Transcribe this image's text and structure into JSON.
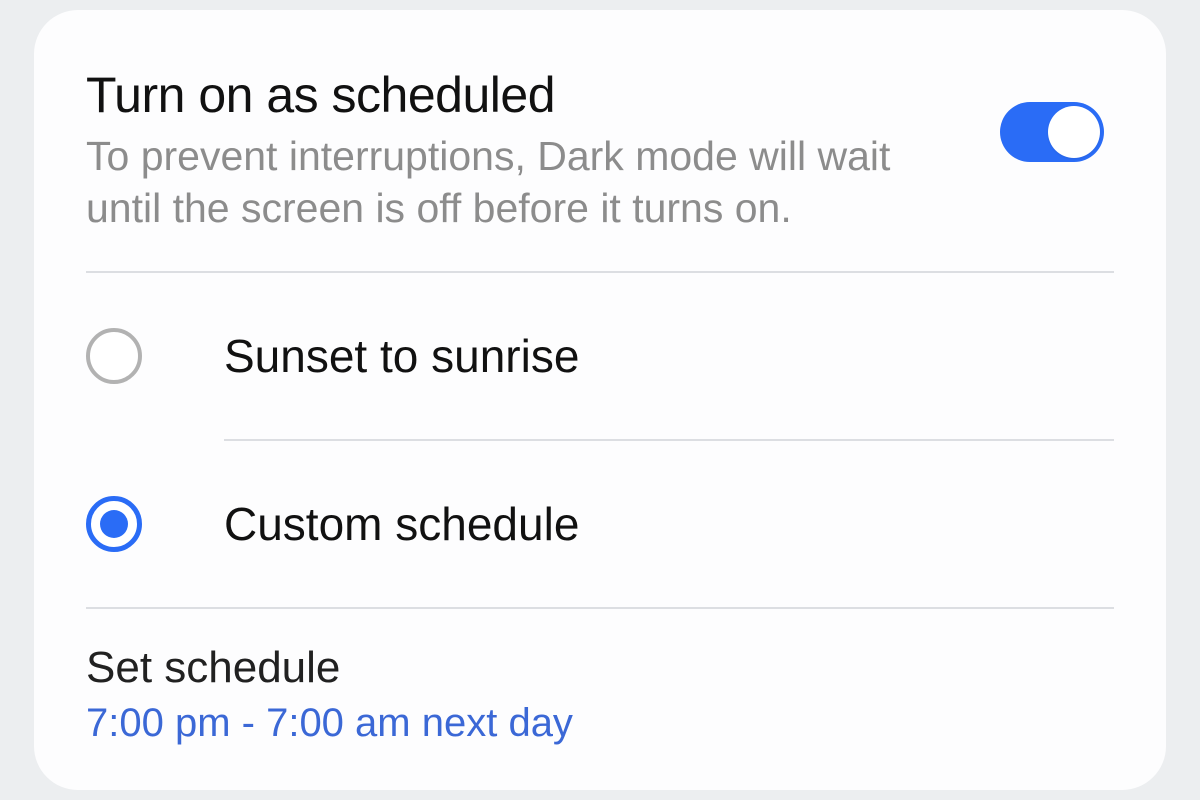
{
  "header": {
    "title": "Turn on as scheduled",
    "subtitle": "To prevent interruptions, Dark mode will wait until the screen is off before it turns on."
  },
  "toggle": {
    "on": true
  },
  "options": {
    "sunset": {
      "label": "Sunset to sunrise",
      "selected": false
    },
    "custom": {
      "label": "Custom schedule",
      "selected": true
    }
  },
  "schedule": {
    "title": "Set schedule",
    "value": "7:00 pm - 7:00 am next day"
  },
  "colors": {
    "accent": "#2a6cf6",
    "text_secondary": "#8c8c8c",
    "link": "#3b68d6",
    "divider": "#dcdee2",
    "card_bg": "#fdfdfe",
    "page_bg": "#eceef0"
  }
}
